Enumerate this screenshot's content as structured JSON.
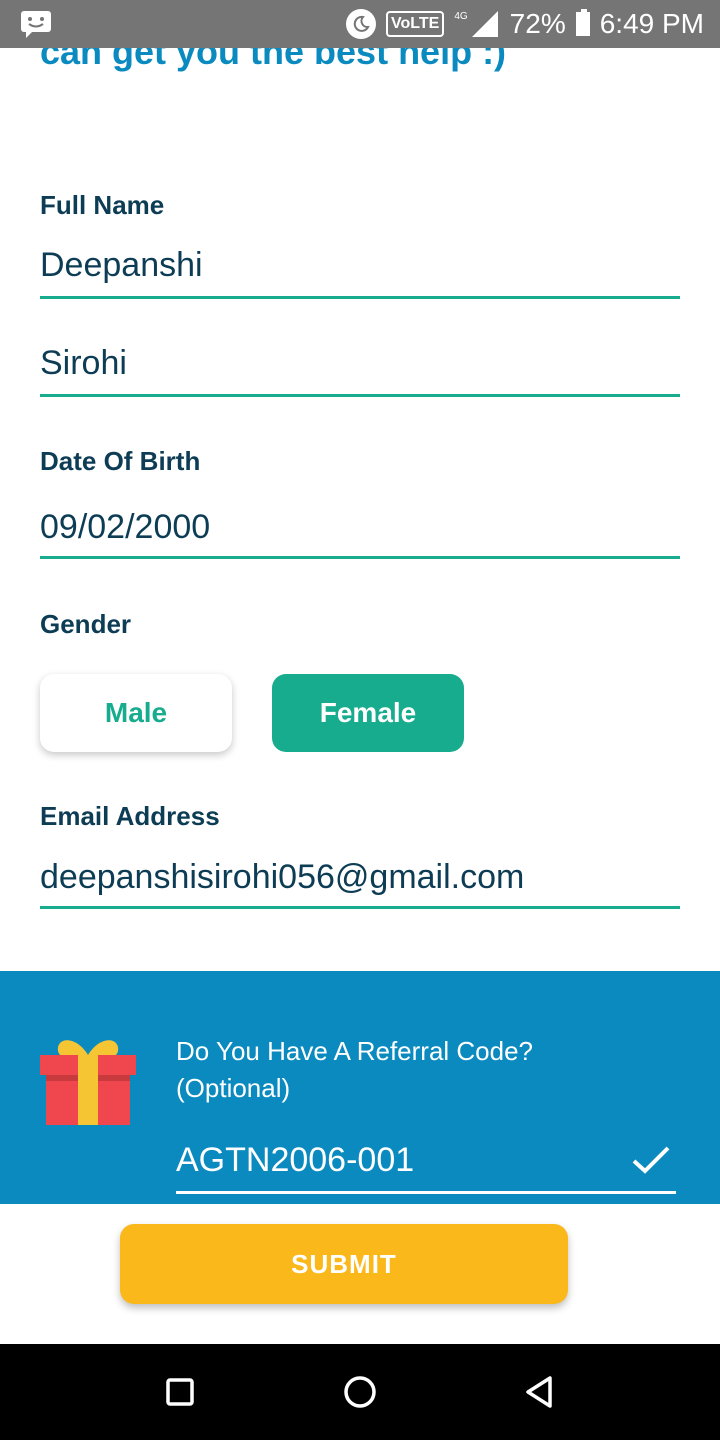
{
  "status_bar": {
    "volte": "VoLTE",
    "network": "4G",
    "battery": "72%",
    "time": "6:49 PM",
    "icons": [
      "message-icon",
      "moon-icon",
      "signal-icon",
      "battery-icon"
    ]
  },
  "header": {
    "partial_text": "can get you the best help :)"
  },
  "form": {
    "full_name_label": "Full Name",
    "first_name_value": "Deepanshi",
    "last_name_value": "Sirohi",
    "dob_label": "Date Of Birth",
    "dob_value": "09/02/2000",
    "gender_label": "Gender",
    "gender_options": [
      "Male",
      "Female"
    ],
    "gender_selected": "Female",
    "email_label": "Email Address",
    "email_value": "deepanshisirohi056@gmail.com"
  },
  "referral": {
    "question_line1": "Do You Have A Referral Code?",
    "question_line2": "(Optional)",
    "code_value": "AGTN2006-001",
    "icons": [
      "gift-icon",
      "check-icon"
    ]
  },
  "submit_label": "SUBMIT",
  "colors": {
    "accent_green": "#17ac8d",
    "brand_blue": "#0a8abf",
    "submit_yellow": "#fbb81a",
    "text_dark": "#0d3c55"
  }
}
